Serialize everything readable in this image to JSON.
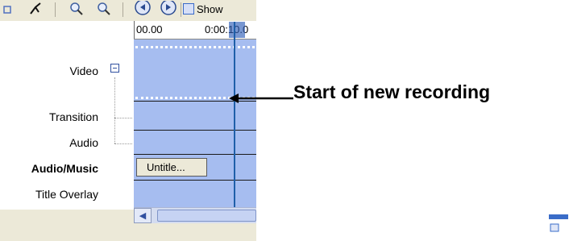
{
  "toolbar": {
    "show_label": "Show"
  },
  "ruler": {
    "start_time": "00.00",
    "mark_time": "0:00:10.0"
  },
  "tracks": {
    "video": "Video",
    "transition": "Transition",
    "audio": "Audio",
    "audio_music": "Audio/Music",
    "title_overlay": "Title Overlay"
  },
  "clip": {
    "label": "Untitle..."
  },
  "annotation": {
    "text": "Start of new recording"
  },
  "colors": {
    "timeline": "#a6bdf0",
    "playhead": "#1f5fa8",
    "window_bg": "#ece9d8"
  },
  "icons": [
    "split-icon",
    "zoom-in-icon",
    "zoom-out-icon",
    "rewind-icon",
    "play-icon",
    "storyboard-icon",
    "scroll-left-icon"
  ]
}
